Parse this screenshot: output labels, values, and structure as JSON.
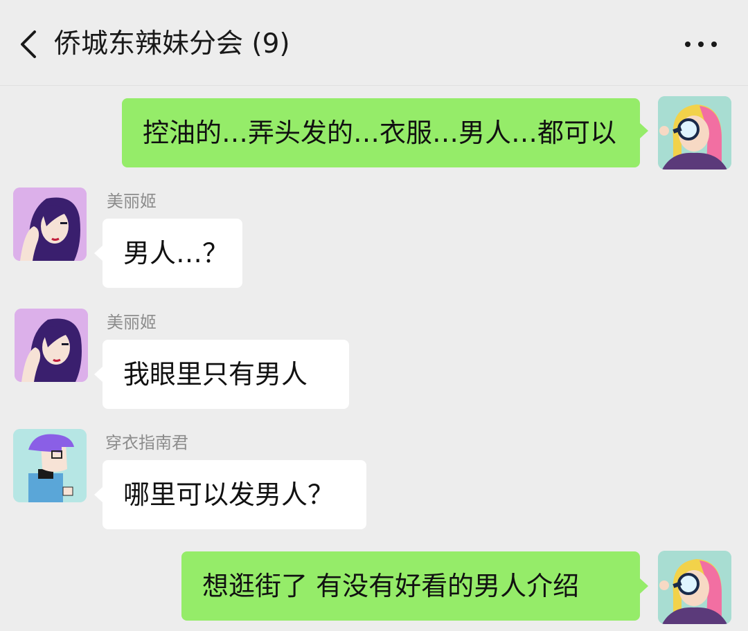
{
  "header": {
    "title": "侨城东辣妹分会 (9)",
    "back_icon": "chevron-left-icon",
    "more_icon": "ellipsis-icon"
  },
  "colors": {
    "background": "#ededed",
    "outgoing_bubble": "#95ec69",
    "incoming_bubble": "#ffffff",
    "sender_name": "#8c8c8c"
  },
  "messages": [
    {
      "direction": "out",
      "sender": "",
      "text": "控油的…弄头发的…衣服…男人…都可以",
      "avatar": "pink-hair-magnifier-avatar"
    },
    {
      "direction": "in",
      "sender": "美丽姬",
      "text": "男人…？",
      "avatar": "purple-hair-woman-avatar"
    },
    {
      "direction": "in",
      "sender": "美丽姬",
      "text": "我眼里只有男人",
      "avatar": "purple-hair-woman-avatar"
    },
    {
      "direction": "in",
      "sender": "穿衣指南君",
      "text": "哪里可以发男人？",
      "avatar": "purple-hat-man-avatar"
    },
    {
      "direction": "out",
      "sender": "",
      "text": "想逛街了 有没有好看的男人介绍",
      "avatar": "pink-hair-magnifier-avatar"
    }
  ]
}
